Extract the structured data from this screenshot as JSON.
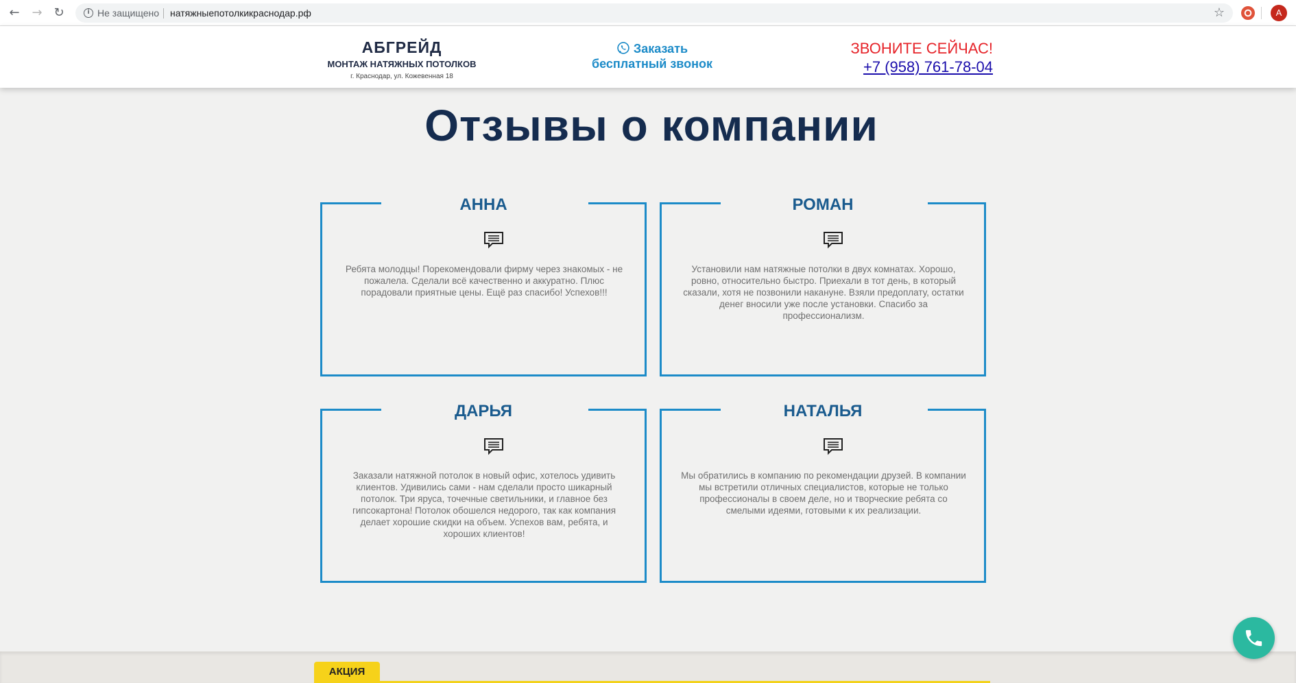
{
  "browser": {
    "security_label": "Не защищено",
    "url": "натяжныепотолкикраснодар.рф",
    "profile_initial": "A",
    "icons": [
      "back-arrow-icon",
      "forward-arrow-icon",
      "reload-icon",
      "info-icon",
      "star-icon",
      "extension-icon"
    ]
  },
  "header": {
    "logo_title": "АБГРЕЙД",
    "logo_subtitle": "МОНТАЖ НАТЯЖНЫХ ПОТОЛКОВ",
    "logo_address": "г. Краснодар, ул. Кожевенная 18",
    "callback_line1": "Заказать",
    "callback_line2": "бесплатный звонок",
    "call_cta": "ЗВОНИТЕ СЕЙЧАС!",
    "phone": "+7 (958) 761-78-04"
  },
  "section": {
    "title": "Отзывы о компании"
  },
  "reviews": [
    {
      "name": "АННА",
      "text": "Ребята молодцы! Порекомендовали фирму через знакомых - не пожалела. Сделали всё качественно и аккуратно. Плюс порадовали приятные цены. Ещё раз спасибо! Успехов!!!"
    },
    {
      "name": "РОМАН",
      "text": "Установили нам натяжные потолки в двух комнатах. Хорошо, ровно, относительно быстро. Приехали в тот день, в который сказали, хотя не позвонили накануне. Взяли предоплату, остатки денег вносили уже после установки. Спасибо за профессионализм."
    },
    {
      "name": "ДАРЬЯ",
      "text": "Заказали натяжной потолок в новый офис, хотелось удивить клиентов. Удивились сами - нам сделали просто шикарный потолок. Три яруса, точечные светильники, и главное без гипсокартона! Потолок обошелся недорого, так как компания делает хорошие скидки на объем. Успехов вам, ребята, и хороших клиентов!"
    },
    {
      "name": "НАТАЛЬЯ",
      "text": "Мы обратились в компанию по рекомендации друзей. В компании мы встретили отличных специалистов, которые не только профессионалы в своем деле, но и творческие ребята со смелыми идеями, готовыми к их реализации."
    }
  ],
  "promo": {
    "tab_label": "АКЦИЯ"
  },
  "colors": {
    "accent_blue": "#1c8bc8",
    "title_navy": "#152c4f",
    "cta_red": "#e6242a",
    "fab_green": "#2bb9a0",
    "promo_yellow": "#f6d21a"
  }
}
